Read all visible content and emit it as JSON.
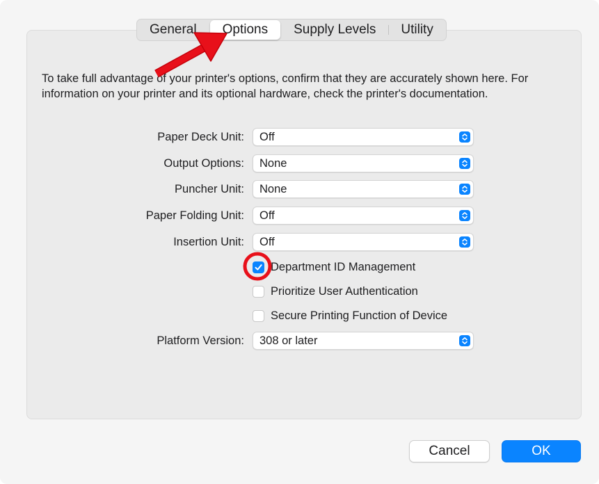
{
  "tabs": [
    {
      "label": "General",
      "active": false
    },
    {
      "label": "Options",
      "active": true
    },
    {
      "label": "Supply Levels",
      "active": false
    },
    {
      "label": "Utility",
      "active": false
    }
  ],
  "description": "To take full advantage of your printer's options, confirm that they are accurately shown here. For information on your printer and its optional hardware, check the printer's documentation.",
  "options": [
    {
      "label": "Paper Deck Unit:",
      "value": "Off"
    },
    {
      "label": "Output Options:",
      "value": "None"
    },
    {
      "label": "Puncher Unit:",
      "value": "None"
    },
    {
      "label": "Paper Folding Unit:",
      "value": "Off"
    },
    {
      "label": "Insertion Unit:",
      "value": "Off"
    }
  ],
  "checkboxes": [
    {
      "label": "Department ID Management",
      "checked": true
    },
    {
      "label": "Prioritize User Authentication",
      "checked": false
    },
    {
      "label": "Secure Printing Function of Device",
      "checked": false
    }
  ],
  "platform": {
    "label": "Platform Version:",
    "value": "308 or later"
  },
  "buttons": {
    "cancel": "Cancel",
    "ok": "OK"
  },
  "colors": {
    "accent": "#0a84ff",
    "annotation": "#e8101a"
  },
  "icons": {
    "stepper": "popup-stepper-icon",
    "checkmark": "checkmark-icon",
    "annotation_arrow": "arrow-annotation",
    "annotation_circle": "circle-annotation"
  }
}
